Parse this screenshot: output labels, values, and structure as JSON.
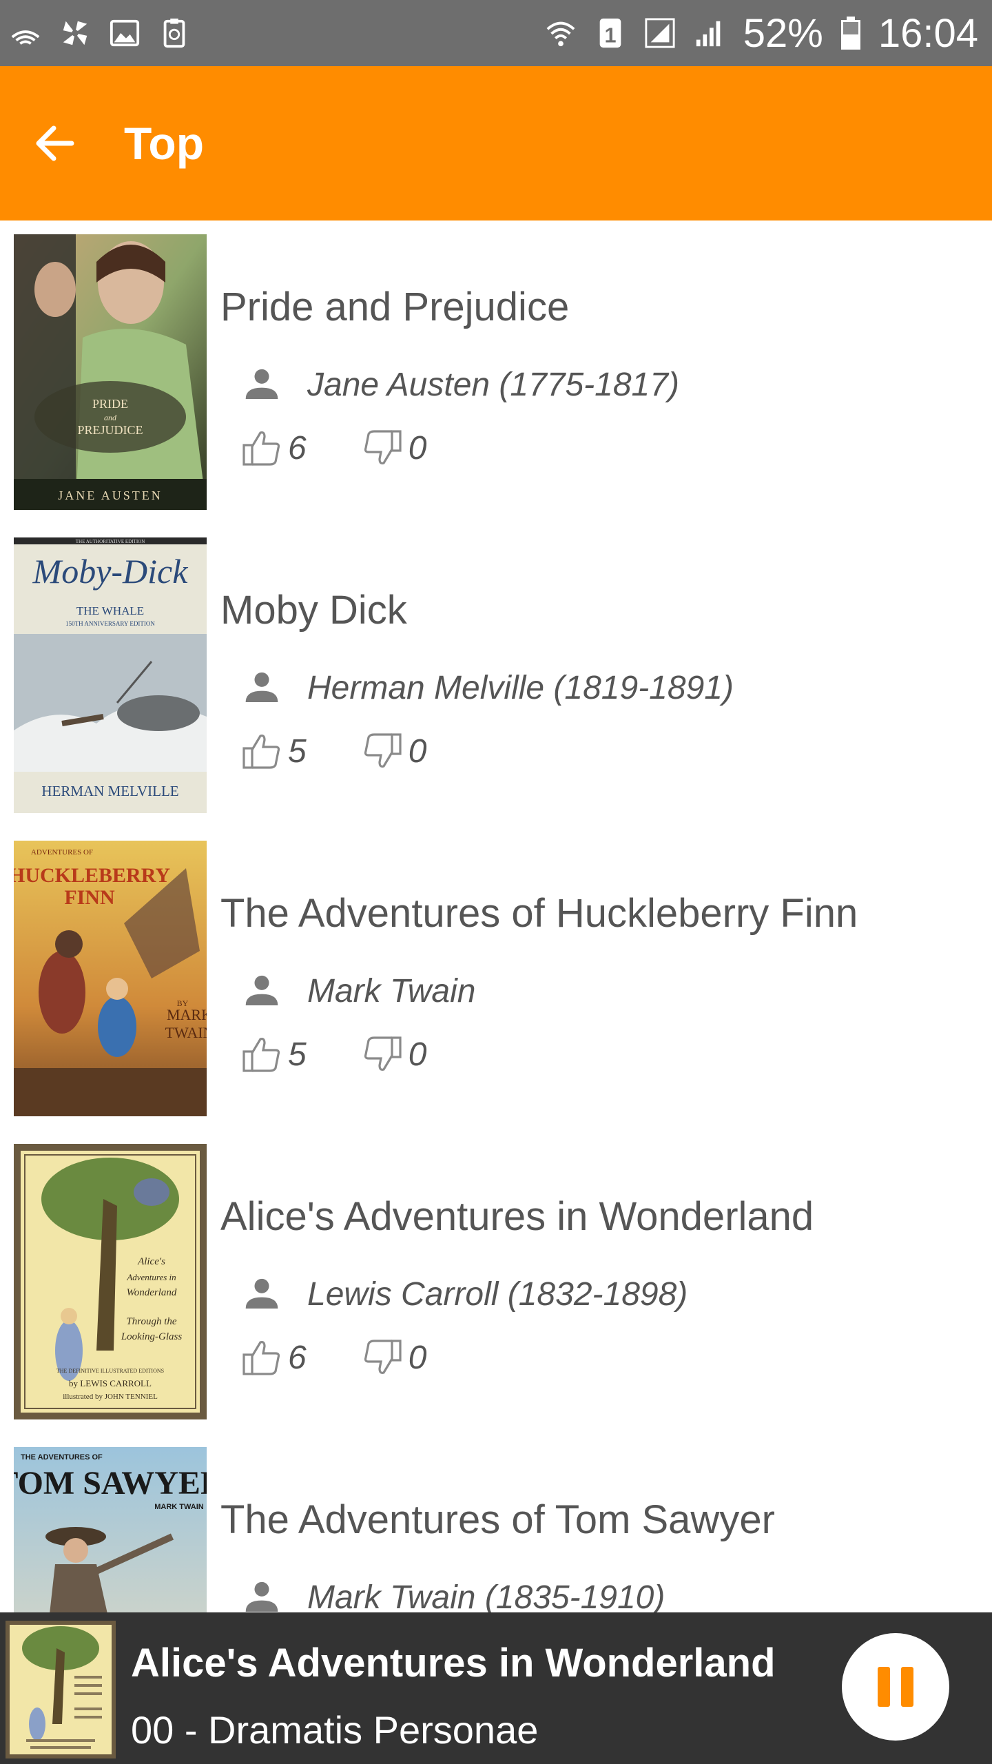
{
  "status_bar": {
    "left_icons": [
      "wifi-broadcast-icon",
      "pinwheel-icon",
      "image-icon",
      "recycle-clipboard-icon"
    ],
    "right_icons": [
      "wifi-icon",
      "sim-icon",
      "signal-icon",
      "signal-icon",
      "battery-icon"
    ],
    "sim_label": "1",
    "battery": "52%",
    "time": "16:04"
  },
  "app_bar": {
    "title": "Top",
    "back_icon": "arrow-left-icon",
    "color": "#ff8c00"
  },
  "books": [
    {
      "title": "Pride and Prejudice",
      "author": "Jane Austen (1775-1817)",
      "likes": "6",
      "dislikes": "0",
      "cover": {
        "line1": "PRIDE",
        "line2": "and",
        "line3": "PREJUDICE",
        "author": "JANE AUSTEN"
      }
    },
    {
      "title": "Moby Dick",
      "author": "Herman Melville (1819-1891)",
      "likes": "5",
      "dislikes": "0",
      "cover": {
        "top": "THE AUTHORITATIVE EDITION",
        "title": "Moby-Dick",
        "subtitle": "THE WHALE",
        "edition": "150TH ANNIVERSARY EDITION",
        "author": "HERMAN MELVILLE"
      }
    },
    {
      "title": "The Adventures of Huckleberry Finn",
      "author": "Mark Twain",
      "likes": "5",
      "dislikes": "0",
      "cover": {
        "top": "ADVENTURES OF",
        "title": "HUCKLEBERRY",
        "title2": "FINN",
        "by": "BY",
        "author1": "MARK",
        "author2": "TWAIN"
      }
    },
    {
      "title": "Alice's Adventures in Wonderland",
      "author": "Lewis Carroll (1832-1898)",
      "likes": "6",
      "dislikes": "0",
      "cover": {
        "line1": "Alice's",
        "line2": "Adventures in",
        "line3": "Wonderland",
        "line4": "Through the",
        "line5": "Looking-Glass",
        "edition": "THE DEFINITIVE ILLUSTRATED EDITIONS",
        "author": "by LEWIS CARROLL",
        "illustrator": "illustrated by JOHN TENNIEL"
      }
    },
    {
      "title": "The Adventures of Tom Sawyer",
      "author": "Mark Twain (1835-1910)",
      "likes": "",
      "dislikes": "",
      "cover": {
        "top": "THE ADVENTURES OF",
        "title": "TOM SAWYER",
        "author": "MARK TWAIN"
      }
    }
  ],
  "player": {
    "title": "Alice's Adventures in Wonderland",
    "chapter": "00 - Dramatis Personae",
    "button_icon": "pause-icon",
    "accent": "#ff8c00"
  }
}
